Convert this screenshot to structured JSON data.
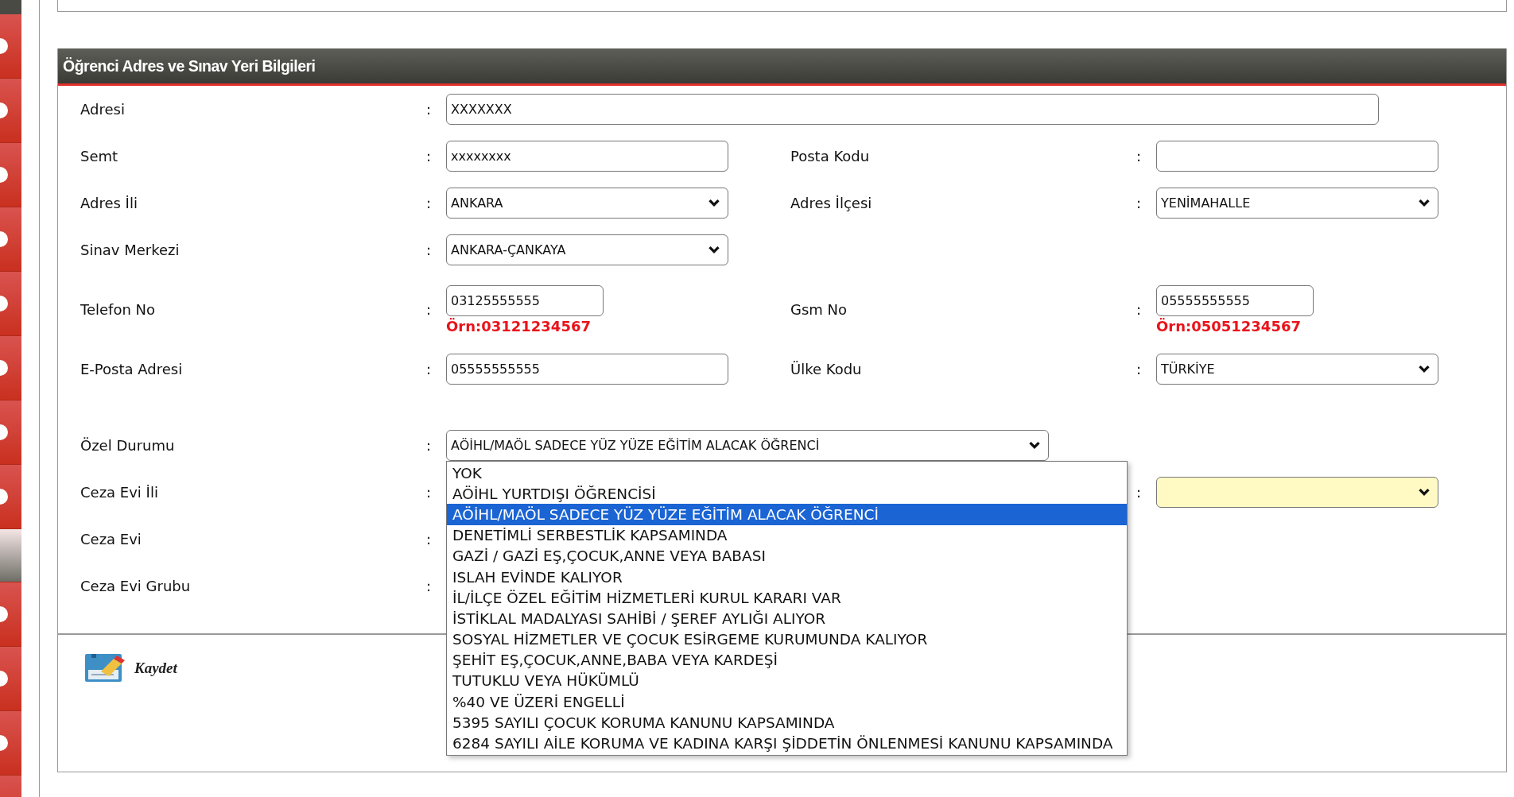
{
  "sidebar": {
    "items": [
      {
        "selected": false
      },
      {
        "selected": false
      },
      {
        "selected": false
      },
      {
        "selected": false
      },
      {
        "selected": false
      },
      {
        "selected": false
      },
      {
        "selected": false
      },
      {
        "selected": false
      },
      {
        "selected": true
      },
      {
        "selected": false
      },
      {
        "selected": false
      },
      {
        "selected": false
      },
      {
        "selected": false
      }
    ]
  },
  "section": {
    "title": "Öğrenci Adres ve Sınav Yeri Bilgileri",
    "groups": [
      [
        {
          "left": {
            "label": "Adresi",
            "colon": ":",
            "kind": "long_text",
            "value": "XXXXXXX"
          }
        },
        {
          "left": {
            "label": "Semt",
            "colon": ":",
            "kind": "text",
            "value": "xxxxxxxx"
          },
          "right": {
            "label": "Posta Kodu",
            "colon": ":",
            "kind": "text"
          }
        },
        {
          "left": {
            "label": "Adres İli",
            "colon": ":",
            "kind": "select",
            "value": "ANKARA"
          },
          "right": {
            "label": "Adres İlçesi",
            "colon": ":",
            "kind": "select",
            "value": "YENİMAHALLE"
          }
        },
        {
          "left": {
            "label": "Sinav Merkezi",
            "colon": ":",
            "kind": "select",
            "value": "ANKARA-ÇANKAYA"
          }
        },
        {
          "left": {
            "label": "Telefon No",
            "colon": ":",
            "kind": "short_text",
            "value": "03125555555",
            "hint": "Örn:03121234567"
          },
          "right": {
            "label": "Gsm No",
            "colon": ":",
            "kind": "short_text",
            "value": "05555555555",
            "hint": "Örn:05051234567"
          }
        },
        {
          "left": {
            "label": "E-Posta Adresi",
            "colon": ":",
            "kind": "text",
            "value": "05555555555"
          },
          "right": {
            "label": "Ülke Kodu",
            "colon": ":",
            "kind": "select",
            "value": "TÜRKİYE"
          }
        }
      ],
      [
        {
          "left": {
            "label": "Özel Durumu",
            "colon": ":",
            "kind": "wide_select",
            "value": "AÖİHL/MAÖL SADECE YÜZ YÜZE EĞİTİM ALACAK ÖĞRENCİ",
            "expanded": true,
            "options": [
              {
                "label": "YOK",
                "selected": false
              },
              {
                "label": "AÖİHL YURTDIŞI ÖĞRENCİSİ",
                "selected": false
              },
              {
                "label": "AÖİHL/MAÖL SADECE YÜZ YÜZE EĞİTİM ALACAK ÖĞRENCİ",
                "selected": true
              },
              {
                "label": "DENETİMLİ SERBESTLİK KAPSAMINDA",
                "selected": false
              },
              {
                "label": "GAZİ / GAZİ EŞ,ÇOCUK,ANNE VEYA BABASI",
                "selected": false
              },
              {
                "label": "ISLAH EVİNDE KALIYOR",
                "selected": false
              },
              {
                "label": "İL/İLÇE ÖZEL EĞİTİM HİZMETLERİ KURUL KARARI VAR",
                "selected": false
              },
              {
                "label": "İSTİKLAL MADALYASI SAHİBİ / ŞEREF AYLIĞI ALIYOR",
                "selected": false
              },
              {
                "label": "SOSYAL HİZMETLER VE ÇOCUK ESİRGEME KURUMUNDA KALIYOR",
                "selected": false
              },
              {
                "label": "ŞEHİT EŞ,ÇOCUK,ANNE,BABA VEYA KARDEŞİ",
                "selected": false
              },
              {
                "label": "TUTUKLU VEYA HÜKÜMLÜ",
                "selected": false
              },
              {
                "label": "%40 VE ÜZERİ ENGELLİ",
                "selected": false
              },
              {
                "label": "5395 SAYILI ÇOCUK KORUMA KANUNU KAPSAMINDA",
                "selected": false
              },
              {
                "label": "6284 SAYILI AİLE KORUMA VE KADINA KARŞI ŞİDDETİN ÖNLENMESİ KANUNU KAPSAMINDA",
                "selected": false
              }
            ]
          }
        },
        {
          "left": {
            "label": "Ceza Evi İli",
            "colon": ":",
            "kind": "none"
          },
          "right": {
            "colon": ":",
            "kind": "select",
            "highlighted": true
          }
        },
        {
          "left": {
            "label": "Ceza Evi",
            "colon": ":",
            "kind": "none"
          }
        },
        {
          "left": {
            "label": "Ceza Evi Grubu",
            "colon": ":",
            "kind": "none"
          }
        }
      ]
    ],
    "save_button": {
      "label": "Kaydet"
    }
  }
}
